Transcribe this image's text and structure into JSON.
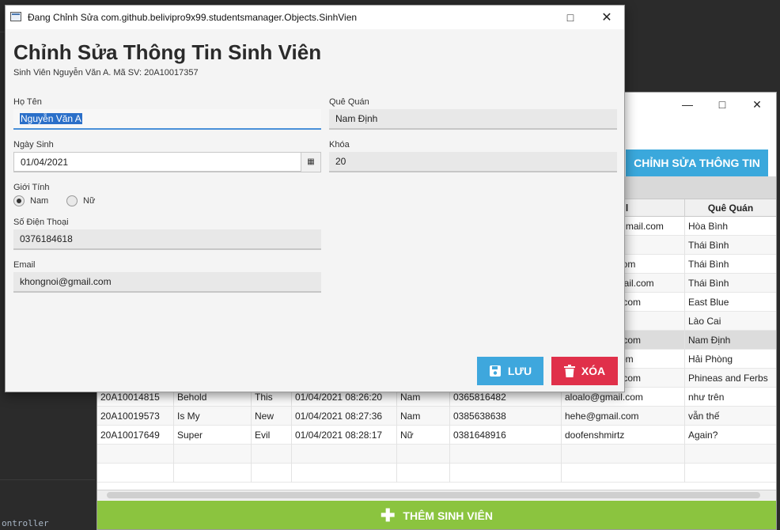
{
  "background": {
    "code_snippet": "ontroller"
  },
  "back_window": {
    "edit_button_label": "CHỈNH SỬA THÔNG TIN",
    "columns": [
      "ail",
      "Quê Quán"
    ],
    "upper_rows": [
      {
        "email": "@gmail.com",
        "hometown": "Hòa Bình"
      },
      {
        "email": "om",
        "hometown": "Thái Bình"
      },
      {
        "email": "il.com",
        "hometown": "Thái Bình"
      },
      {
        "email": "gmail.com",
        "hometown": "Thái Bình"
      },
      {
        "email": "ail.com",
        "hometown": "East Blue"
      },
      {
        "email": "m",
        "hometown": "Lào Cai"
      },
      {
        "email": "ail.com",
        "hometown": "Nam Định"
      },
      {
        "email": "l.com",
        "hometown": "Hải Phòng"
      },
      {
        "email": "ail.com",
        "hometown": "Phineas and Ferbs"
      }
    ],
    "lower_rows": [
      {
        "id": "20A10014815",
        "c2": "Behold",
        "c3": "This",
        "date": "01/04/2021 08:26:20",
        "gender": "Nam",
        "phone": "0365816482",
        "email": "aloalo@gmail.com",
        "hometown": "như trên"
      },
      {
        "id": "20A10019573",
        "c2": "Is My",
        "c3": "New",
        "date": "01/04/2021 08:27:36",
        "gender": "Nam",
        "phone": "0385638638",
        "email": "hehe@gmail.com",
        "hometown": "vẫn thế"
      },
      {
        "id": "20A10017649",
        "c2": "Super",
        "c3": "Evil",
        "date": "01/04/2021 08:28:17",
        "gender": "Nữ",
        "phone": "0381648916",
        "email": "doofenshmirtz",
        "hometown": "Again?"
      }
    ],
    "add_button_label": "THÊM SINH VIÊN"
  },
  "dialog": {
    "title": "Đang Chỉnh Sửa com.github.belivipro9x99.studentsmanager.Objects.SinhVien",
    "heading": "Chỉnh Sửa Thông Tin Sinh Viên",
    "subheading": "Sinh Viên Nguyễn Văn A. Mã SV: 20A10017357",
    "fields": {
      "name_label": "Họ Tên",
      "name_value": "Nguyễn Văn A",
      "hometown_label": "Quê Quán",
      "hometown_value": "Nam Định",
      "dob_label": "Ngày Sinh",
      "dob_value": "01/04/2021",
      "course_label": "Khóa",
      "course_value": "20",
      "gender_label": "Giới Tính",
      "gender_male": "Nam",
      "gender_female": "Nữ",
      "phone_label": "Số Điện Thoại",
      "phone_value": "0376184618",
      "email_label": "Email",
      "email_value": "khongnoi@gmail.com"
    },
    "save_label": "LƯU",
    "delete_label": "XÓA"
  }
}
